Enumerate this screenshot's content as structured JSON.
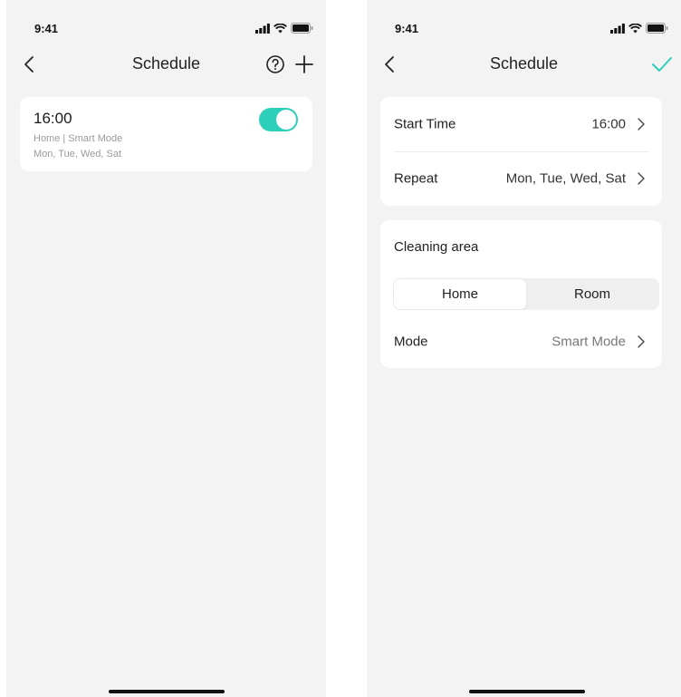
{
  "colors": {
    "accent": "#2dcfba",
    "background": "#f3f3f3",
    "card": "#ffffff"
  },
  "left_screen": {
    "status_time": "9:41",
    "title": "Schedule",
    "icons": [
      "back-chevron-icon",
      "help-circle-icon",
      "plus-icon"
    ],
    "schedule": {
      "time": "16:00",
      "summary": "Home | Smart Mode",
      "days": "Mon, Tue, Wed, Sat",
      "enabled": true
    }
  },
  "right_screen": {
    "status_time": "9:41",
    "title": "Schedule",
    "icons": [
      "back-chevron-icon",
      "checkmark-icon"
    ],
    "start_time": {
      "label": "Start Time",
      "value": "16:00"
    },
    "repeat": {
      "label": "Repeat",
      "value": "Mon, Tue, Wed, Sat"
    },
    "cleaning_area": {
      "label": "Cleaning area",
      "options": [
        "Home",
        "Room"
      ],
      "selected": "Home"
    },
    "mode": {
      "label": "Mode",
      "value": "Smart Mode"
    }
  }
}
